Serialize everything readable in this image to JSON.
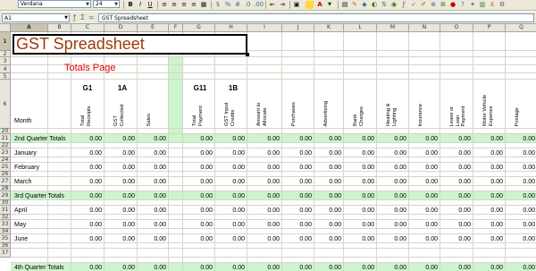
{
  "toolbar": {
    "font_name": "Verdana",
    "font_size": "24",
    "bold_label": "B",
    "italic_label": "I",
    "underline_label": "U"
  },
  "formula_bar": {
    "cell_ref": "A1",
    "content": "GST Spreadsheet"
  },
  "columns": [
    "A",
    "B",
    "C",
    "D",
    "E",
    "F",
    "G",
    "H",
    "I",
    "J",
    "K",
    "L",
    "M",
    "N",
    "O",
    "P",
    "Q"
  ],
  "rows": [
    "1",
    "2",
    "3",
    "4",
    "5",
    "6",
    "20",
    "21",
    "22",
    "23",
    "24",
    "25",
    "26",
    "27",
    "28",
    "29",
    "30",
    "31",
    "32",
    "33",
    "34",
    "35",
    "36",
    "37"
  ],
  "sheet": {
    "title": "GST Spreadsheet",
    "subtitle": "Totals Page",
    "codes": {
      "g1": "G1",
      "1a": "1A",
      "g11": "G11",
      "1b": "1B"
    },
    "month_header": "Month",
    "headers": [
      "Total Receipts",
      "GST Collected",
      "Sales",
      "Total Payment",
      "GST Input Credits",
      "Amount to Allocate",
      "Purchases",
      "Advertising",
      "Bank Charges",
      "Heating & Lighting",
      "Insurance",
      "Lease or Loan Payment",
      "Motor Vehicle Expense",
      "Postage"
    ],
    "data_rows": [
      {
        "label": "2nd Quarter Totals",
        "value": "0.00"
      },
      {
        "label": "January",
        "value": "0.00"
      },
      {
        "label": "February",
        "value": "0.00"
      },
      {
        "label": "March",
        "value": "0.00"
      },
      {
        "label": "3rd Quarter Totals",
        "value": "0.00"
      },
      {
        "label": "April",
        "value": "0.00"
      },
      {
        "label": "May",
        "value": "0.00"
      },
      {
        "label": "June",
        "value": "0.00"
      },
      {
        "label": "4th Quarter Totals",
        "value": "0.00"
      }
    ]
  },
  "colors": {
    "title_text": "#9e3a0a",
    "subtitle_text": "#e00000",
    "quarter_band": "#ccf5cc"
  }
}
